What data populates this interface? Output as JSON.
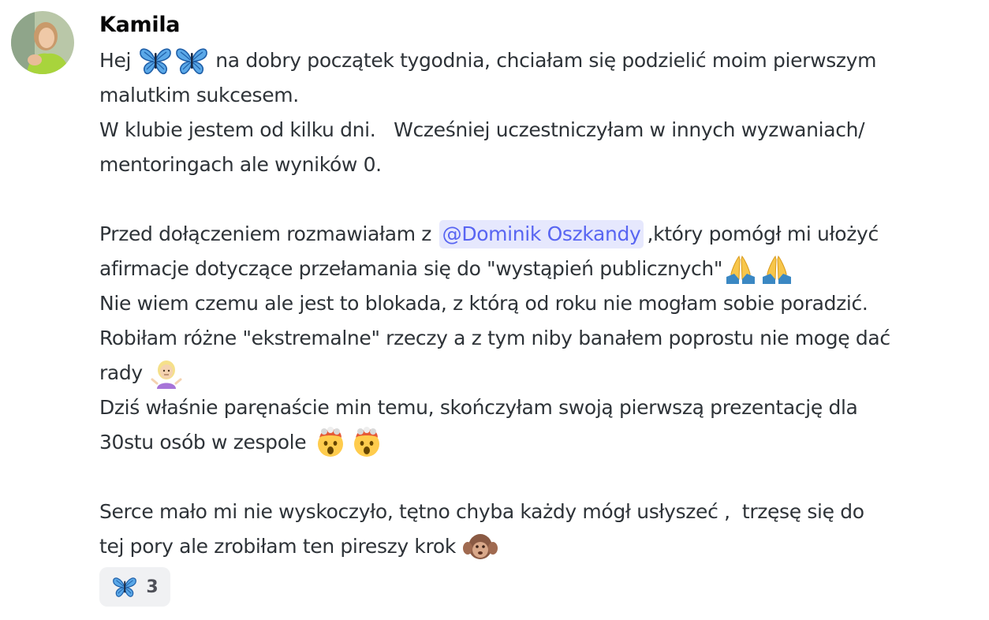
{
  "message": {
    "author": "Kamila",
    "lines": [
      {
        "parts": [
          {
            "t": "Hej "
          },
          {
            "e": "butterfly-icon"
          },
          {
            "e": "butterfly-icon"
          },
          {
            "t": " na dobry początek tygodnia, chciałam się podzielić moim pierwszym"
          }
        ]
      },
      {
        "parts": [
          {
            "t": "malutkim sukcesem."
          }
        ]
      },
      {
        "parts": [
          {
            "t": "W klubie jestem od kilku dni.   Wcześniej uczestniczyłam w innych wyzwaniach/"
          }
        ]
      },
      {
        "parts": [
          {
            "t": "mentoringach ale wyników 0."
          }
        ]
      },
      {
        "parts": []
      },
      {
        "parts": [
          {
            "t": "Przed dołączeniem rozmawiałam z "
          },
          {
            "m": "@Dominik Oszkandy"
          },
          {
            "t": ",który pomógł mi ułożyć"
          }
        ]
      },
      {
        "parts": [
          {
            "t": "afirmacje dotyczące przełamania się do \"wystąpień publicznych\""
          },
          {
            "e": "folded-hands-icon"
          },
          {
            "e": "folded-hands-icon"
          }
        ]
      },
      {
        "parts": [
          {
            "t": "Nie wiem czemu ale jest to blokada, z którą od roku nie mogłam sobie poradzić."
          }
        ]
      },
      {
        "parts": [
          {
            "t": "Robiłam różne \"ekstremalne\" rzeczy a z tym niby banałem poprostu nie mogę dać"
          }
        ]
      },
      {
        "parts": [
          {
            "t": "rady "
          },
          {
            "e": "person-shrugging-icon"
          }
        ]
      },
      {
        "parts": [
          {
            "t": "Dziś właśnie paręnaście min temu, skończyłam swoją pierwszą prezentację dla"
          }
        ]
      },
      {
        "parts": [
          {
            "t": "30stu osób w zespole "
          },
          {
            "e": "exploding-head-icon"
          },
          {
            "e": "exploding-head-icon"
          }
        ]
      },
      {
        "parts": []
      },
      {
        "parts": [
          {
            "t": "Serce mało mi nie wyskoczyło, tętno chyba każdy mógł usłyszeć ,  trzęsę się do"
          }
        ]
      },
      {
        "parts": [
          {
            "t": "tej pory ale zrobiłam ten pireszy krok "
          },
          {
            "e": "hear-no-evil-monkey-icon"
          }
        ]
      }
    ]
  },
  "reaction": {
    "emoji": "butterfly-icon",
    "count": "3"
  },
  "colors": {
    "mention_bg": "#e6e8fd",
    "mention_text": "#5865f2",
    "text": "#2e3338",
    "reaction_bg": "#f0f1f3"
  }
}
